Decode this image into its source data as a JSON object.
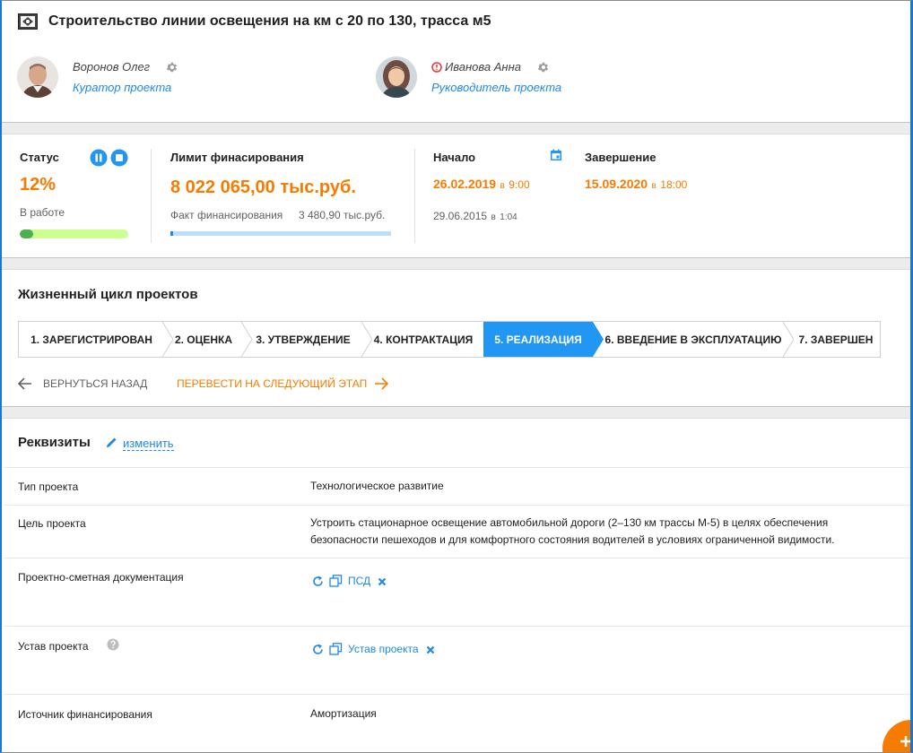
{
  "project": {
    "title": "Строительство линии освещения на км с 20 по 130, трасса м5"
  },
  "people": [
    {
      "name": "Воронов Олег",
      "role": "Куратор проекта",
      "alert": false
    },
    {
      "name": "Иванова Анна",
      "role": "Руководитель проекта",
      "alert": true
    }
  ],
  "status": {
    "label": "Статус",
    "percent": "12%",
    "state": "В работе",
    "progress": 0.12
  },
  "funding": {
    "label": "Лимит финасирования",
    "amount": "8 022 065,00 тыс.руб.",
    "fact_label": "Факт финансирования",
    "fact_amount": "3 480,90 тыс.руб.",
    "fact_progress": 0.005
  },
  "dates": {
    "start_label": "Начало",
    "start_date": "26.02.2019",
    "start_time_prefix": "в",
    "start_time": "9:00",
    "start_plan_date": "29.06.2015",
    "start_plan_prefix": "в",
    "start_plan_time": "1:04",
    "end_label": "Завершение",
    "end_date": "15.09.2020",
    "end_time_prefix": "в",
    "end_time": "18:00"
  },
  "lifecycle": {
    "title": "Жизненный цикл проектов",
    "steps": [
      "1. ЗАРЕГИСТРИРОВАН",
      "2. ОЦЕНКА",
      "3. УТВЕРЖДЕНИЕ",
      "4. КОНТРАКТАЦИЯ",
      "5. РЕАЛИЗАЦИЯ",
      "6. ВВЕДЕНИЕ В ЭКСПЛУАТАЦИЮ",
      "7. ЗАВЕРШЕН"
    ],
    "active_index": 4,
    "back_label": "ВЕРНУТЬСЯ НАЗАД",
    "next_label": "ПЕРЕВЕСТИ НА СЛЕДУЮЩИЙ ЭТАП"
  },
  "requisites": {
    "title": "Реквизиты",
    "edit_label": "изменить",
    "rows": [
      {
        "label": "Тип проекта",
        "value": "Технологическое развитие"
      },
      {
        "label": "Цель проекта",
        "value": "Устроить стационарное освещение автомобильной дороги (2–130 км трассы М-5) в целях обеспечения безопасности пешеходов и для комфортного состояния водителей в условиях ограниченной видимости."
      },
      {
        "label": "Проектно-сметная документация",
        "value": "ПСД"
      },
      {
        "label": "Устав проекта",
        "value": "Устав проекта"
      },
      {
        "label": "Источник финансирования",
        "value": "Амортизация"
      }
    ]
  },
  "colors": {
    "accent": "#2196f3",
    "highlight": "#f57c00",
    "progress_green": "#4caf50",
    "progress_light": "#ccff90"
  }
}
